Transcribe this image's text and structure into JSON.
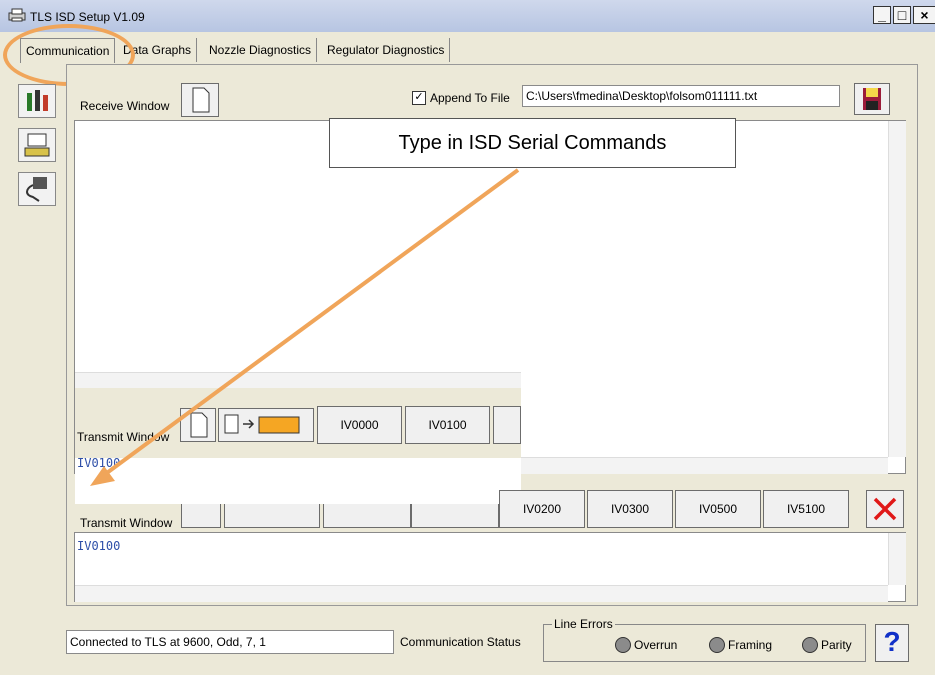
{
  "window": {
    "title": "TLS ISD Setup V1.09"
  },
  "tabs": [
    {
      "label": "Communication"
    },
    {
      "label": "Data Graphs"
    },
    {
      "label": "Nozzle Diagnostics"
    },
    {
      "label": "Regulator Diagnostics"
    }
  ],
  "receive": {
    "label": "Receive Window",
    "append_label": "Append To File",
    "append_checked": true,
    "file_path": "C:\\Users\\fmedina\\Desktop\\folsom011111.txt"
  },
  "transmit": {
    "label": "Transmit Window",
    "command_value": "IV0100",
    "buttons_overlay": [
      "IV0000",
      "IV0100"
    ],
    "buttons_main": [
      "IV0200",
      "IV0300",
      "IV0500",
      "IV5100"
    ]
  },
  "status": {
    "connection_text": "Connected to TLS at 9600, Odd, 7, 1",
    "label": "Communication Status",
    "line_errors_label": "Line Errors",
    "errors": [
      "Overrun",
      "Framing",
      "Parity"
    ]
  },
  "callout": {
    "text": "Type in ISD Serial Commands"
  },
  "colors": {
    "annotation": "#f0a55a",
    "tab_highlight": "#f0a55a",
    "command_text": "#2e4fa8",
    "delete_x": "#e01818"
  }
}
